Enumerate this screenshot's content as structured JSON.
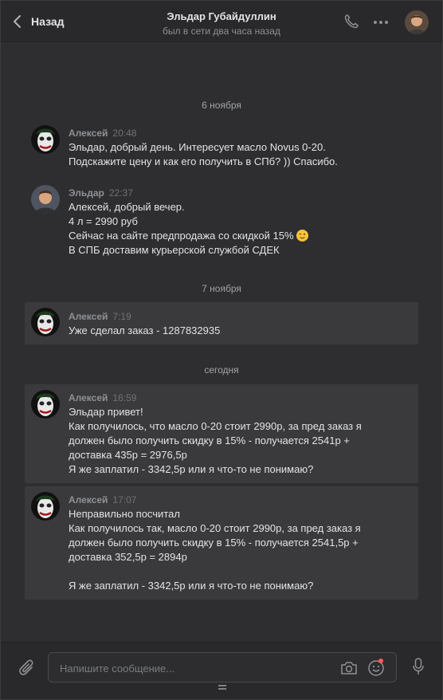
{
  "header": {
    "back_label": "Назад",
    "title": "Эльдар Губайдуллин",
    "subtitle": "был в сети два часа назад"
  },
  "dates": {
    "d1": "6 ноября",
    "d2": "7 ноября",
    "d3": "сегодня"
  },
  "messages": [
    {
      "author": "Алексей",
      "time": "20:48",
      "avatar": "joker-avatar",
      "lines": [
        "Эльдар, добрый день. Интересует масло Novus 0-20.",
        "Подскажите цену и как его получить в СПб? )) Спасибо."
      ]
    },
    {
      "author": "Эльдар",
      "time": "22:37",
      "avatar": "eldar-avatar",
      "lines": [
        "Алексей, добрый вечер.",
        "4 л = 2990 руб",
        "Сейчас на сайте предпродажа со скидкой 15%",
        "В СПБ доставим курьерской службой СДЕК"
      ]
    },
    {
      "author": "Алексей",
      "time": "7:19",
      "avatar": "joker-avatar",
      "lines": [
        "Уже сделал заказ - 1287832935"
      ]
    },
    {
      "author": "Алексей",
      "time": "16:59",
      "avatar": "joker-avatar",
      "lines": [
        "Эльдар привет!",
        "Как получилось, что масло 0-20 стоит 2990р, за пред заказ я",
        "должен было получить скидку в 15% - получается 2541р +",
        "доставка 435р = 2976,5р",
        "Я же заплатил - 3342,5р или я что-то не понимаю?"
      ]
    },
    {
      "author": "Алексей",
      "time": "17:07",
      "avatar": "joker-avatar",
      "lines": [
        "Неправильно посчитал",
        "Как получилось так, масло 0-20 стоит 2990р, за пред заказ я",
        "должен было получить скидку в 15% - получается 2541,5р +",
        "доставка 352,5р = 2894р",
        "",
        "Я же заплатил - 3342,5р или я что-то не понимаю?"
      ]
    }
  ],
  "composer": {
    "placeholder": "Напишите сообщение..."
  },
  "colors": {
    "background": "#2e2e30",
    "highlight": "#3a3a3c",
    "author": "#8e9196",
    "notification": "#ff5c5c"
  }
}
